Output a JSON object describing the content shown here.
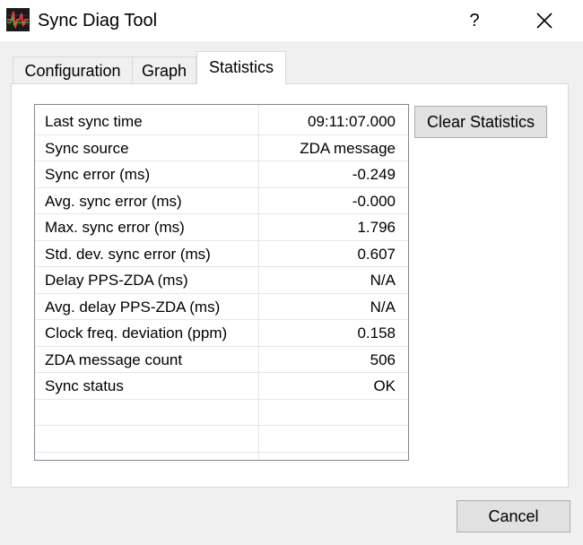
{
  "window": {
    "title": "Sync Diag Tool",
    "help_label": "?",
    "icon": "waveform-app-icon",
    "close_icon": "close-icon"
  },
  "tabs": [
    {
      "label": "Configuration",
      "active": false
    },
    {
      "label": "Graph",
      "active": false
    },
    {
      "label": "Statistics",
      "active": true
    }
  ],
  "statistics": {
    "rows": [
      {
        "name": "Last sync time",
        "value": "09:11:07.000"
      },
      {
        "name": "Sync source",
        "value": "ZDA message"
      },
      {
        "name": "Sync error (ms)",
        "value": "-0.249"
      },
      {
        "name": "Avg. sync error (ms)",
        "value": "-0.000"
      },
      {
        "name": "Max. sync error (ms)",
        "value": "1.796"
      },
      {
        "name": "Std. dev. sync error (ms)",
        "value": "0.607"
      },
      {
        "name": "Delay PPS-ZDA (ms)",
        "value": "N/A"
      },
      {
        "name": "Avg. delay PPS-ZDA (ms)",
        "value": "N/A"
      },
      {
        "name": "Clock freq. deviation (ppm)",
        "value": "0.158"
      },
      {
        "name": "ZDA message count",
        "value": "506"
      },
      {
        "name": "Sync status",
        "value": "OK"
      },
      {
        "name": "",
        "value": ""
      },
      {
        "name": "",
        "value": ""
      },
      {
        "name": "",
        "value": ""
      }
    ]
  },
  "buttons": {
    "clear_statistics": "Clear Statistics",
    "cancel": "Cancel"
  }
}
